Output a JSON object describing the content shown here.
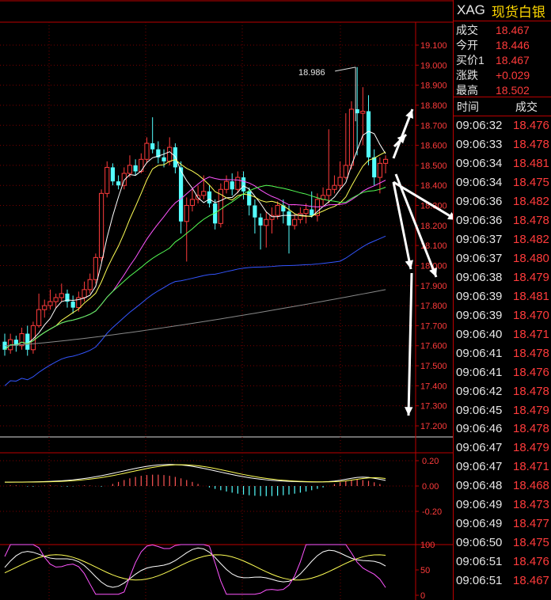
{
  "header": {
    "symbol": "XAG",
    "name": "现货白银"
  },
  "quote": [
    {
      "label": "成交",
      "value": "18.467"
    },
    {
      "label": "今开",
      "value": "18.446"
    },
    {
      "label": "买价1",
      "value": "18.467"
    },
    {
      "label": "涨跌",
      "value": "+0.029"
    },
    {
      "label": "最高",
      "value": "18.502"
    }
  ],
  "ticks_header": {
    "time": "时间",
    "price": "成交"
  },
  "ticks": [
    {
      "time": "09:06:32",
      "price": "18.476"
    },
    {
      "time": "09:06:33",
      "price": "18.478"
    },
    {
      "time": "09:06:34",
      "price": "18.481"
    },
    {
      "time": "09:06:34",
      "price": "18.475"
    },
    {
      "time": "09:06:36",
      "price": "18.482"
    },
    {
      "time": "09:06:36",
      "price": "18.478"
    },
    {
      "time": "09:06:37",
      "price": "18.482"
    },
    {
      "time": "09:06:37",
      "price": "18.480"
    },
    {
      "time": "09:06:38",
      "price": "18.479"
    },
    {
      "time": "09:06:39",
      "price": "18.481"
    },
    {
      "time": "09:06:39",
      "price": "18.470"
    },
    {
      "time": "09:06:40",
      "price": "18.471"
    },
    {
      "time": "09:06:41",
      "price": "18.478"
    },
    {
      "time": "09:06:41",
      "price": "18.476"
    },
    {
      "time": "09:06:42",
      "price": "18.478"
    },
    {
      "time": "09:06:45",
      "price": "18.479"
    },
    {
      "time": "09:06:46",
      "price": "18.478"
    },
    {
      "time": "09:06:47",
      "price": "18.479"
    },
    {
      "time": "09:06:47",
      "price": "18.471"
    },
    {
      "time": "09:06:48",
      "price": "18.468"
    },
    {
      "time": "09:06:49",
      "price": "18.473"
    },
    {
      "time": "09:06:49",
      "price": "18.477"
    },
    {
      "time": "09:06:50",
      "price": "18.475"
    },
    {
      "time": "09:06:51",
      "price": "18.476"
    },
    {
      "time": "09:06:51",
      "price": "18.467"
    }
  ],
  "chart_data": {
    "type": "candlestick",
    "price_axis": [
      "19.100",
      "19.000",
      "18.900",
      "18.800",
      "18.700",
      "18.600",
      "18.500",
      "18.400",
      "18.300",
      "18.200",
      "18.100",
      "18.000",
      "17.900",
      "17.800",
      "17.700",
      "17.600",
      "17.500",
      "17.400",
      "17.300",
      "17.200"
    ],
    "peak_label": "18.986",
    "macd_axis": [
      "0.20",
      "0.00",
      "-0.20"
    ],
    "kdj_axis": [
      "100",
      "50",
      "0"
    ],
    "candles": [
      [
        17.62,
        17.58,
        17.66,
        17.55
      ],
      [
        17.58,
        17.63,
        17.66,
        17.56
      ],
      [
        17.63,
        17.6,
        17.65,
        17.57
      ],
      [
        17.6,
        17.66,
        17.69,
        17.58
      ],
      [
        17.66,
        17.58,
        17.7,
        17.55
      ],
      [
        17.58,
        17.7,
        17.72,
        17.56
      ],
      [
        17.7,
        17.78,
        17.86,
        17.69
      ],
      [
        17.78,
        17.8,
        17.83,
        17.74
      ],
      [
        17.8,
        17.82,
        17.88,
        17.78
      ],
      [
        17.82,
        17.84,
        17.86,
        17.79
      ],
      [
        17.84,
        17.86,
        17.91,
        17.82
      ],
      [
        17.86,
        17.82,
        17.88,
        17.79
      ],
      [
        17.82,
        17.79,
        17.85,
        17.76
      ],
      [
        17.79,
        17.84,
        17.87,
        17.77
      ],
      [
        17.84,
        17.88,
        17.92,
        17.82
      ],
      [
        17.88,
        17.93,
        17.96,
        17.86
      ],
      [
        17.93,
        18.04,
        18.06,
        17.91
      ],
      [
        18.04,
        18.36,
        18.38,
        18.02
      ],
      [
        18.36,
        18.49,
        18.52,
        18.34
      ],
      [
        18.49,
        18.42,
        18.51,
        18.4
      ],
      [
        18.42,
        18.4,
        18.45,
        18.38
      ],
      [
        18.4,
        18.46,
        18.49,
        18.38
      ],
      [
        18.46,
        18.5,
        18.55,
        18.44
      ],
      [
        18.5,
        18.47,
        18.53,
        18.45
      ],
      [
        18.47,
        18.53,
        18.56,
        18.46
      ],
      [
        18.53,
        18.61,
        18.64,
        18.51
      ],
      [
        18.61,
        18.58,
        18.74,
        18.56
      ],
      [
        18.58,
        18.54,
        18.62,
        18.51
      ],
      [
        18.54,
        18.52,
        18.58,
        18.49
      ],
      [
        18.52,
        18.59,
        18.64,
        18.5
      ],
      [
        18.59,
        18.49,
        18.61,
        18.46
      ],
      [
        18.49,
        18.22,
        18.52,
        18.16
      ],
      [
        18.22,
        18.3,
        18.34,
        18.02
      ],
      [
        18.3,
        18.33,
        18.38,
        18.27
      ],
      [
        18.33,
        18.35,
        18.4,
        18.31
      ],
      [
        18.35,
        18.37,
        18.45,
        18.33
      ],
      [
        18.37,
        18.31,
        18.4,
        18.29
      ],
      [
        18.31,
        18.21,
        18.33,
        18.18
      ],
      [
        18.21,
        18.38,
        18.41,
        18.19
      ],
      [
        18.38,
        18.42,
        18.45,
        18.36
      ],
      [
        18.42,
        18.38,
        18.46,
        18.35
      ],
      [
        18.38,
        18.44,
        18.47,
        18.36
      ],
      [
        18.44,
        18.37,
        18.47,
        18.33
      ],
      [
        18.37,
        18.3,
        18.39,
        18.25
      ],
      [
        18.3,
        18.24,
        18.33,
        18.16
      ],
      [
        18.24,
        18.2,
        18.26,
        18.08
      ],
      [
        18.2,
        18.23,
        18.27,
        18.09
      ],
      [
        18.23,
        18.25,
        18.29,
        18.16
      ],
      [
        18.25,
        18.3,
        18.32,
        18.23
      ],
      [
        18.3,
        18.27,
        18.33,
        18.21
      ],
      [
        18.27,
        18.2,
        18.3,
        18.06
      ],
      [
        18.2,
        18.23,
        18.26,
        18.18
      ],
      [
        18.23,
        18.26,
        18.29,
        18.21
      ],
      [
        18.26,
        18.28,
        18.31,
        18.21
      ],
      [
        18.28,
        18.25,
        18.37,
        18.24
      ],
      [
        18.25,
        18.33,
        18.36,
        18.22
      ],
      [
        18.33,
        18.35,
        18.39,
        18.3
      ],
      [
        18.35,
        18.38,
        18.68,
        18.31
      ],
      [
        18.38,
        18.4,
        18.45,
        18.36
      ],
      [
        18.4,
        18.44,
        18.52,
        18.38
      ],
      [
        18.44,
        18.5,
        18.76,
        18.43
      ],
      [
        18.5,
        18.78,
        18.82,
        18.48
      ],
      [
        18.78,
        18.76,
        18.99,
        18.55
      ],
      [
        18.76,
        18.77,
        18.89,
        18.6
      ],
      [
        18.77,
        18.54,
        18.85,
        18.5
      ],
      [
        18.54,
        18.44,
        18.58,
        18.4
      ],
      [
        18.44,
        18.51,
        18.54,
        18.36
      ],
      [
        18.51,
        18.53,
        18.55,
        18.46
      ]
    ]
  }
}
